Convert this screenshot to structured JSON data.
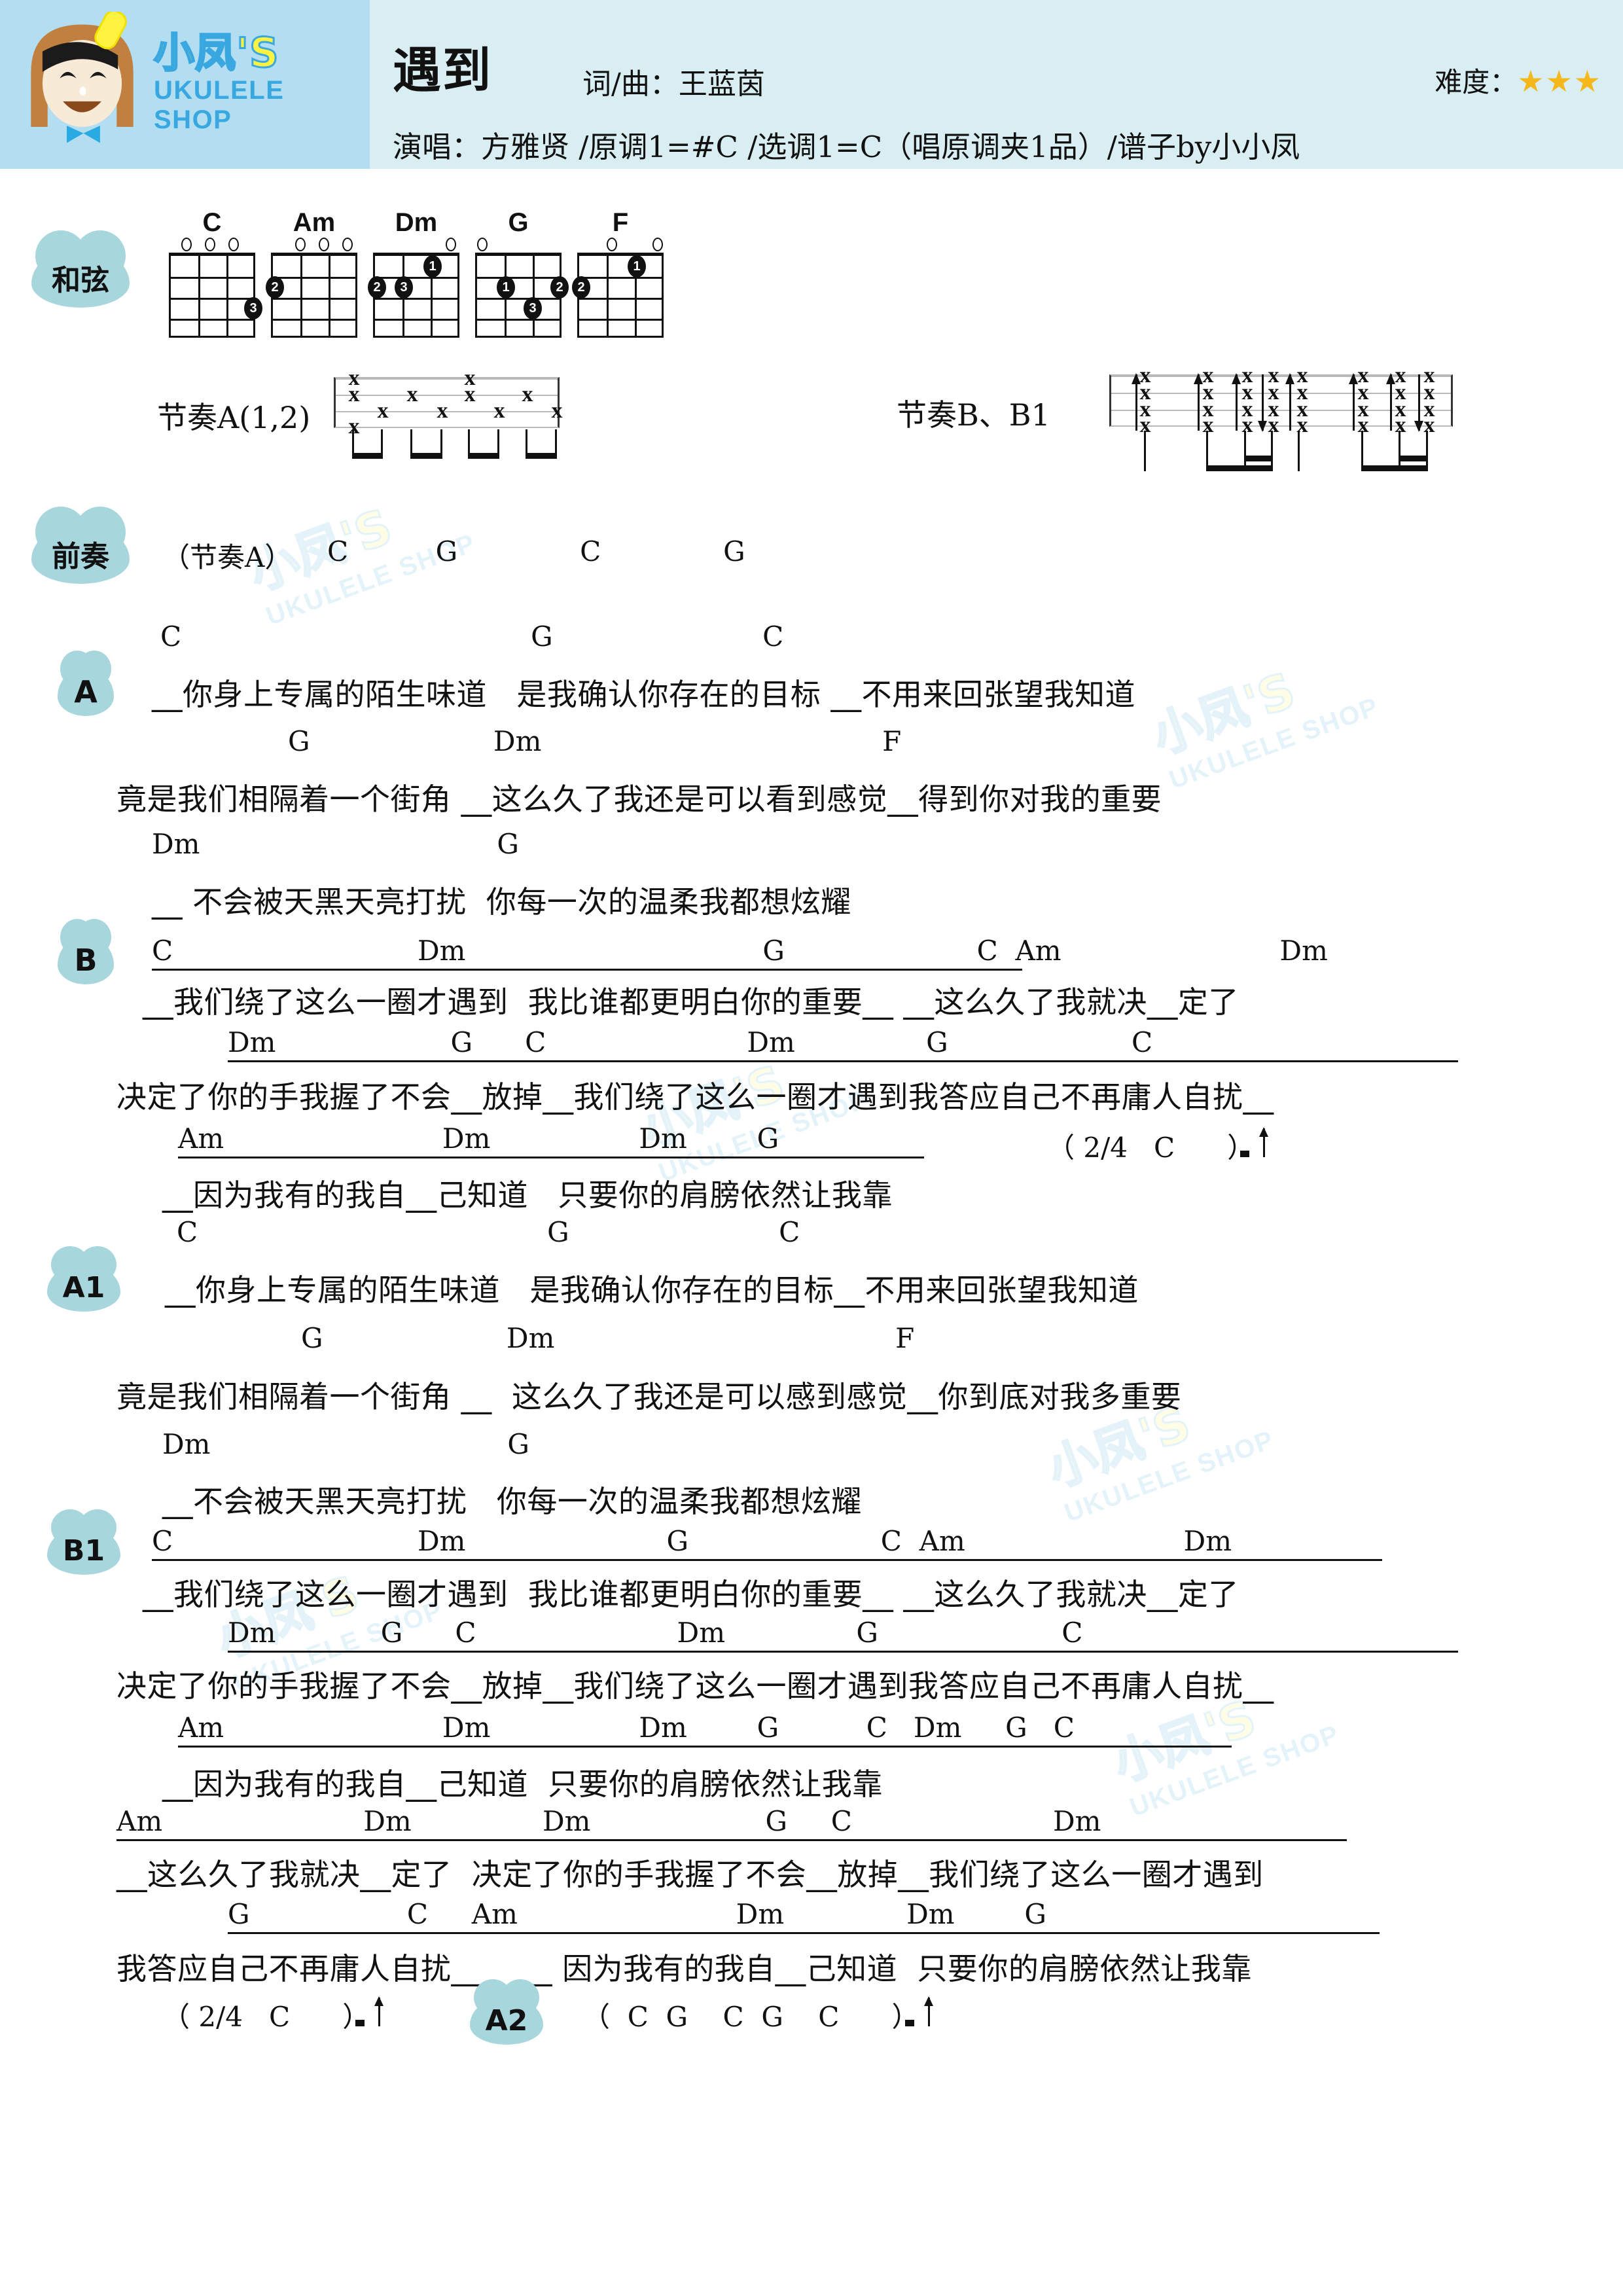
{
  "brand": {
    "cn": "小凤'S",
    "en": "UKULELE SHOP"
  },
  "header": {
    "title": "遇到",
    "composer": "词/曲：王蓝茵",
    "difficulty_label": "难度：",
    "stars": "★★★",
    "performer": "演唱：方雅贤  /原调1=#C  /选调1=C（唱原调夹1品）/谱子by小小凤"
  },
  "labels": {
    "chords": "和弦",
    "intro": "前奏",
    "A": "A",
    "B": "B",
    "A1": "A1",
    "B1": "B1",
    "A2": "A2"
  },
  "chord_diagrams": [
    {
      "name": "C",
      "opens": [
        1,
        1,
        1,
        0
      ],
      "dots": [
        {
          "string": 4,
          "fret": 3,
          "finger": "3"
        }
      ]
    },
    {
      "name": "Am",
      "opens": [
        0,
        1,
        1,
        1
      ],
      "dots": [
        {
          "string": 1,
          "fret": 2,
          "finger": "2"
        }
      ]
    },
    {
      "name": "Dm",
      "opens": [
        0,
        0,
        0,
        1
      ],
      "dots": [
        {
          "string": 1,
          "fret": 2,
          "finger": "2"
        },
        {
          "string": 2,
          "fret": 2,
          "finger": "3"
        },
        {
          "string": 3,
          "fret": 1,
          "finger": "1"
        }
      ]
    },
    {
      "name": "G",
      "opens": [
        1,
        0,
        0,
        0
      ],
      "dots": [
        {
          "string": 2,
          "fret": 2,
          "finger": "1"
        },
        {
          "string": 4,
          "fret": 2,
          "finger": "2"
        },
        {
          "string": 3,
          "fret": 3,
          "finger": "3"
        }
      ]
    },
    {
      "name": "F",
      "opens": [
        0,
        1,
        0,
        1
      ],
      "dots": [
        {
          "string": 1,
          "fret": 2,
          "finger": "2"
        },
        {
          "string": 3,
          "fret": 1,
          "finger": "1"
        }
      ]
    }
  ],
  "rhythms": [
    {
      "label": "节奏A(1,2)"
    },
    {
      "label": "节奏B、B1"
    }
  ],
  "intro": {
    "pattern": "（节奏A）",
    "chords": "C          G              C              G"
  },
  "sections": [
    {
      "tag": "A",
      "lines": [
        {
          "chords": "C                                        G                        C",
          "underline": false,
          "lyric": "__你身上专属的陌生味道   是我确认你存在的目标 __不用来回张望我知道"
        },
        {
          "chords": "G                     Dm                                       F",
          "underline": false,
          "lyric": "竟是我们相隔着一个街角 __这么久了我还是可以看到感觉__得到你对我的重要"
        },
        {
          "chords": "Dm                                  G",
          "underline": false,
          "lyric": "__ 不会被天黑天亮打扰  你每一次的温柔我都想炫耀"
        }
      ]
    },
    {
      "tag": "B",
      "lines": [
        {
          "chords": "C                            Dm                                  G                      C  Am                         Dm",
          "underline": true,
          "lyric": "__我们绕了这么一圈才遇到  我比谁都更明白你的重要__ __这么久了我就决__定了"
        },
        {
          "chords": "Dm                    G      C                       Dm               G                     C",
          "underline": true,
          "lyric": "决定了你的手我握了不会__放掉__我们绕了这么一圈才遇到我答应自己不再庸人自扰__"
        },
        {
          "chords": "Am                         Dm                 Dm        G",
          "underline": true,
          "lyric": "__因为我有的我自__己知道   只要你的肩膀依然让我靠",
          "meta": "（ 2/4   C      ）"
        }
      ]
    },
    {
      "tag": "A1",
      "lines": [
        {
          "chords": "C                                        G                        C",
          "underline": false,
          "lyric": "__你身上专属的陌生味道   是我确认你存在的目标__不用来回张望我知道"
        },
        {
          "chords": "G                     Dm                                       F",
          "underline": false,
          "lyric": "竟是我们相隔着一个街角 __  这么久了我还是可以感到感觉__你到底对我多重要"
        },
        {
          "chords": "Dm                                  G",
          "underline": false,
          "lyric": "__不会被天黑天亮打扰   你每一次的温柔我都想炫耀"
        }
      ]
    },
    {
      "tag": "B1",
      "lines": [
        {
          "chords": "C                            Dm                       G                      C  Am                         Dm",
          "underline": true,
          "lyric": "__我们绕了这么一圈才遇到  我比谁都更明白你的重要__ __这么久了我就决__定了"
        },
        {
          "chords": "Dm            G      C                       Dm               G                     C",
          "underline": true,
          "lyric": "决定了你的手我握了不会__放掉__我们绕了这么一圈才遇到我答应自己不再庸人自扰__"
        },
        {
          "chords": "Am                         Dm                 Dm        G          C   Dm     G   C",
          "underline": true,
          "lyric": "__因为我有的我自__己知道  只要你的肩膀依然让我靠"
        },
        {
          "chords": "Am                       Dm               Dm                    G     C                       Dm",
          "underline": true,
          "lyric": "__这么久了我就决__定了  决定了你的手我握了不会__放掉__我们绕了这么一圈才遇到"
        },
        {
          "chords": "G                  C     Am                         Dm              Dm        G",
          "underline": true,
          "lyric": "我答应自己不再庸人自扰__    __ 因为我有的我自__己知道  只要你的肩膀依然让我靠"
        }
      ],
      "ending": {
        "meta1": "（ 2/4   C      ）",
        "meta2": "（  C  G    C  G    C      ）"
      }
    }
  ]
}
